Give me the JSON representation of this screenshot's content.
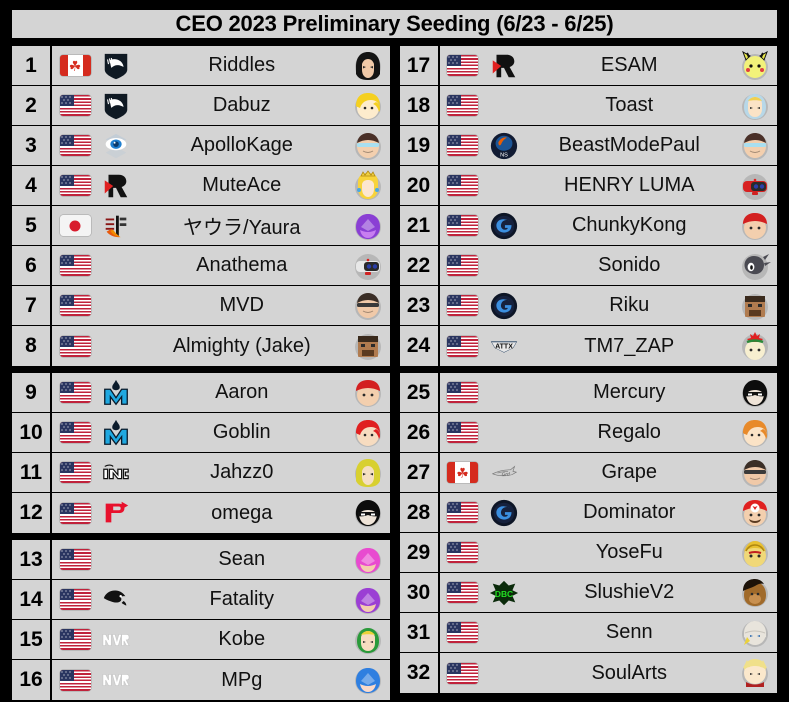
{
  "header": {
    "title": "CEO 2023 Preliminary Seeding (6/23 - 6/25)"
  },
  "colors": {
    "background": "#000000",
    "panel": "#d4d4d4",
    "border": "#000000",
    "text": "#111111"
  },
  "columns": [
    {
      "name": "left-column",
      "groups": [
        {
          "name": "group-1",
          "rows": [
            {
              "seed": "1",
              "country": "CA",
              "team": "team-liquid",
              "name": "Riddles",
              "character": "sephiroth"
            },
            {
              "seed": "2",
              "country": "US",
              "team": "team-liquid",
              "name": "Dabuz",
              "character": "rosalina"
            },
            {
              "seed": "3",
              "country": "US",
              "team": "eye-logo",
              "name": "ApolloKage",
              "character": "wii-fit-trainer"
            },
            {
              "seed": "4",
              "country": "US",
              "team": "rogue",
              "name": "MuteAce",
              "character": "peach"
            },
            {
              "seed": "5",
              "country": "JP",
              "team": "kanji-logo",
              "name": "ヤウラ/Yaura",
              "character": "palutena"
            },
            {
              "seed": "6",
              "country": "US",
              "team": "",
              "name": "Anathema",
              "character": "rob"
            },
            {
              "seed": "7",
              "country": "US",
              "team": "",
              "name": "MVD",
              "character": "snake"
            },
            {
              "seed": "8",
              "country": "US",
              "team": "",
              "name": "Almighty (Jake)",
              "character": "steve"
            }
          ]
        },
        {
          "name": "group-2",
          "rows": [
            {
              "seed": "9",
              "country": "US",
              "team": "moist-esports",
              "name": "Aaron",
              "character": "diddy-kong"
            },
            {
              "seed": "10",
              "country": "US",
              "team": "moist-esports",
              "name": "Goblin",
              "character": "roy"
            },
            {
              "seed": "11",
              "country": "US",
              "team": "inc-gaming",
              "name": "Jahzz0",
              "character": "zelda-sheik"
            },
            {
              "seed": "12",
              "country": "US",
              "team": "panda",
              "name": "omega",
              "character": "joker"
            }
          ]
        },
        {
          "name": "group-3",
          "rows": [
            {
              "seed": "13",
              "country": "US",
              "team": "",
              "name": "Sean",
              "character": "captain-falcon-pink"
            },
            {
              "seed": "14",
              "country": "US",
              "team": "panther",
              "name": "Fatality",
              "character": "captain-falcon-purple"
            },
            {
              "seed": "15",
              "country": "US",
              "team": "nvr",
              "name": "Kobe",
              "character": "young-link"
            },
            {
              "seed": "16",
              "country": "US",
              "team": "nvr",
              "name": "MPg",
              "character": "mega-man"
            }
          ]
        }
      ]
    },
    {
      "name": "right-column",
      "groups": [
        {
          "name": "group-4",
          "rows": [
            {
              "seed": "17",
              "country": "US",
              "team": "rogue",
              "name": "ESAM",
              "character": "pichu"
            },
            {
              "seed": "18",
              "country": "US",
              "team": "",
              "name": "Toast",
              "character": "zelda"
            },
            {
              "seed": "19",
              "country": "US",
              "team": "ns-logo",
              "name": "BeastModePaul",
              "character": "wii-fit-trainer"
            },
            {
              "seed": "20",
              "country": "US",
              "team": "",
              "name": "HENRY LUMA",
              "character": "rob-red"
            },
            {
              "seed": "21",
              "country": "US",
              "team": "cf-logo",
              "name": "ChunkyKong",
              "character": "diddy-kong"
            },
            {
              "seed": "22",
              "country": "US",
              "team": "",
              "name": "Sonido",
              "character": "sonic"
            },
            {
              "seed": "23",
              "country": "US",
              "team": "cf-logo",
              "name": "Riku",
              "character": "steve"
            },
            {
              "seed": "24",
              "country": "US",
              "team": "attx",
              "name": "TM7_ZAP",
              "character": "bowser-jr"
            }
          ]
        },
        {
          "name": "group-5",
          "rows": [
            {
              "seed": "25",
              "country": "US",
              "team": "",
              "name": "Mercury",
              "character": "joker"
            },
            {
              "seed": "26",
              "country": "US",
              "team": "",
              "name": "Regalo",
              "character": "villager"
            },
            {
              "seed": "27",
              "country": "CA",
              "team": "jet-logo",
              "name": "Grape",
              "character": "snake"
            },
            {
              "seed": "28",
              "country": "US",
              "team": "cf-logo",
              "name": "Dominator",
              "character": "mario"
            },
            {
              "seed": "29",
              "country": "US",
              "team": "",
              "name": "YoseFu",
              "character": "bowser"
            },
            {
              "seed": "30",
              "country": "US",
              "team": "dbc",
              "name": "SlushieV2",
              "character": "donkey-kong"
            },
            {
              "seed": "31",
              "country": "US",
              "team": "",
              "name": "Senn",
              "character": "sheik"
            },
            {
              "seed": "32",
              "country": "US",
              "team": "",
              "name": "SoulArts",
              "character": "min-min"
            }
          ]
        }
      ]
    }
  ]
}
